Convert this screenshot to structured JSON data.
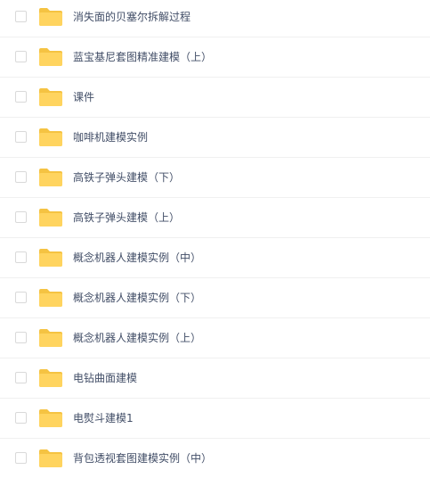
{
  "file_list": {
    "icon": "folder-icon",
    "folder_color": "#ffd45f",
    "items": [
      {
        "name": "消失面的贝塞尔拆解过程"
      },
      {
        "name": "蓝宝基尼套图精准建模（上）"
      },
      {
        "name": "课件"
      },
      {
        "name": "咖啡机建模实例"
      },
      {
        "name": "高铁子弹头建模（下）"
      },
      {
        "name": "高铁子弹头建模（上）"
      },
      {
        "name": "概念机器人建模实例（中）"
      },
      {
        "name": "概念机器人建模实例（下）"
      },
      {
        "name": "概念机器人建模实例（上）"
      },
      {
        "name": "电钻曲面建模"
      },
      {
        "name": "电熨斗建模1"
      },
      {
        "name": "背包透视套图建模实例（中）"
      }
    ]
  }
}
